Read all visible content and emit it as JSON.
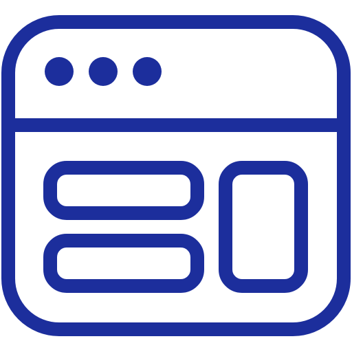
{
  "icon": {
    "name": "browser-window-layout-icon",
    "color": "#1C2E9C",
    "background": "#FFFFFF",
    "parts": {
      "window": "window-frame",
      "titlebar_dots": 3,
      "content_blocks": [
        "wide-block-top",
        "wide-block-bottom",
        "tall-block-right"
      ]
    }
  }
}
